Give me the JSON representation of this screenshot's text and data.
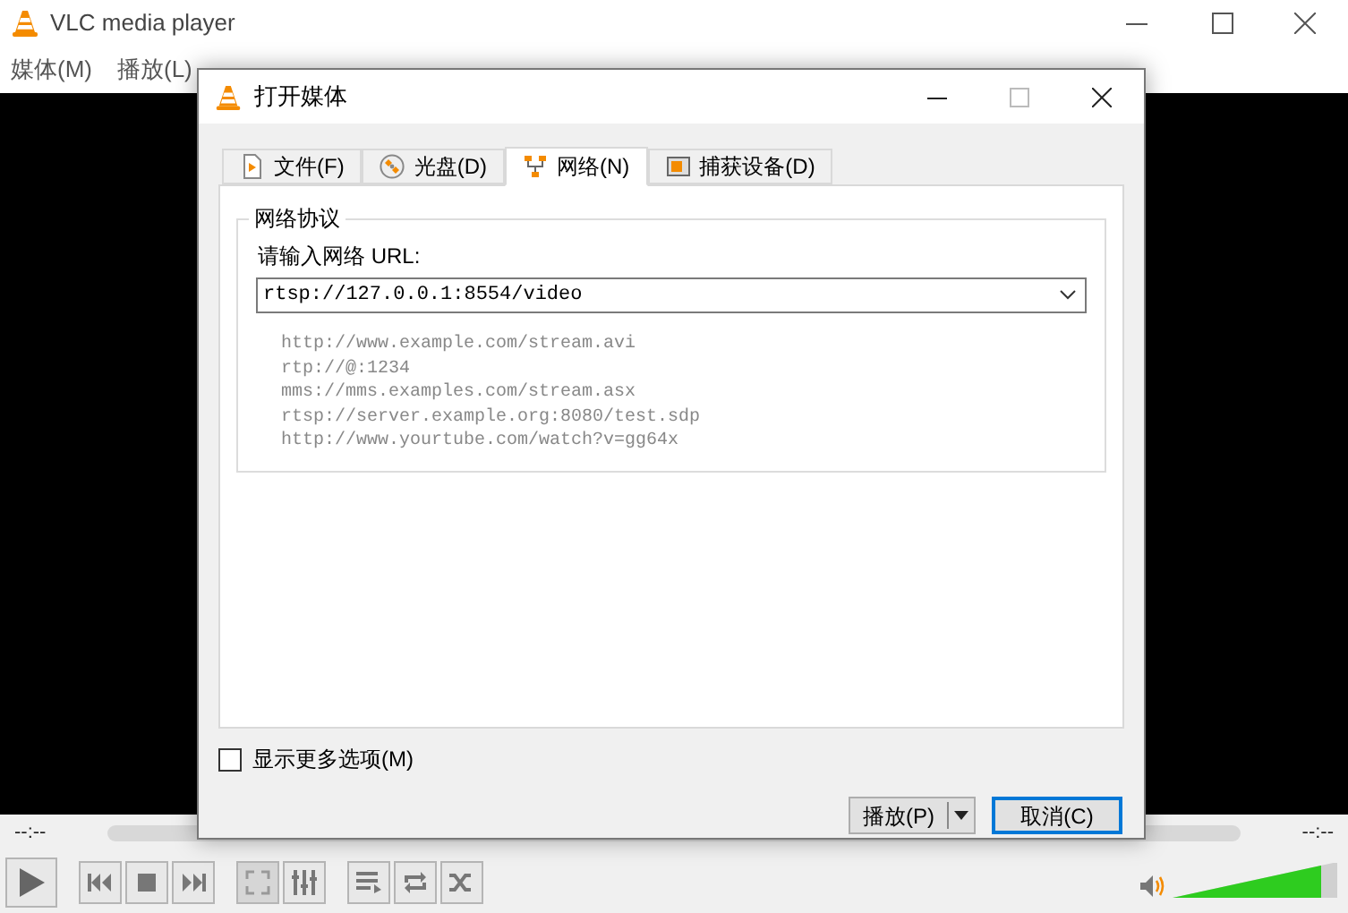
{
  "window": {
    "title": "VLC media player"
  },
  "menu": [
    {
      "label": "媒体(M)"
    },
    {
      "label": "播放(L)"
    }
  ],
  "dialog": {
    "title": "打开媒体",
    "tabs": [
      {
        "label": "文件(F)",
        "selected": false
      },
      {
        "label": "光盘(D)",
        "selected": false
      },
      {
        "label": "网络(N)",
        "selected": true
      },
      {
        "label": "捕获设备(D)",
        "selected": false
      }
    ],
    "group_title": "网络协议",
    "url_label": "请输入网络 URL:",
    "url_value": "rtsp://127.0.0.1:8554/video",
    "examples": [
      "http://www.example.com/stream.avi",
      "rtp://@:1234",
      "mms://mms.examples.com/stream.asx",
      "rtsp://server.example.org:8080/test.sdp",
      "http://www.yourtube.com/watch?v=gg64x"
    ],
    "more_options": {
      "label": "显示更多选项(M)",
      "checked": false
    },
    "play_button": "播放(P)",
    "cancel_button": "取消(C)"
  },
  "player": {
    "elapsed": "--:--",
    "remaining": "--:--",
    "seek": {
      "level": 0
    },
    "volume": {
      "level": 0.9
    }
  }
}
